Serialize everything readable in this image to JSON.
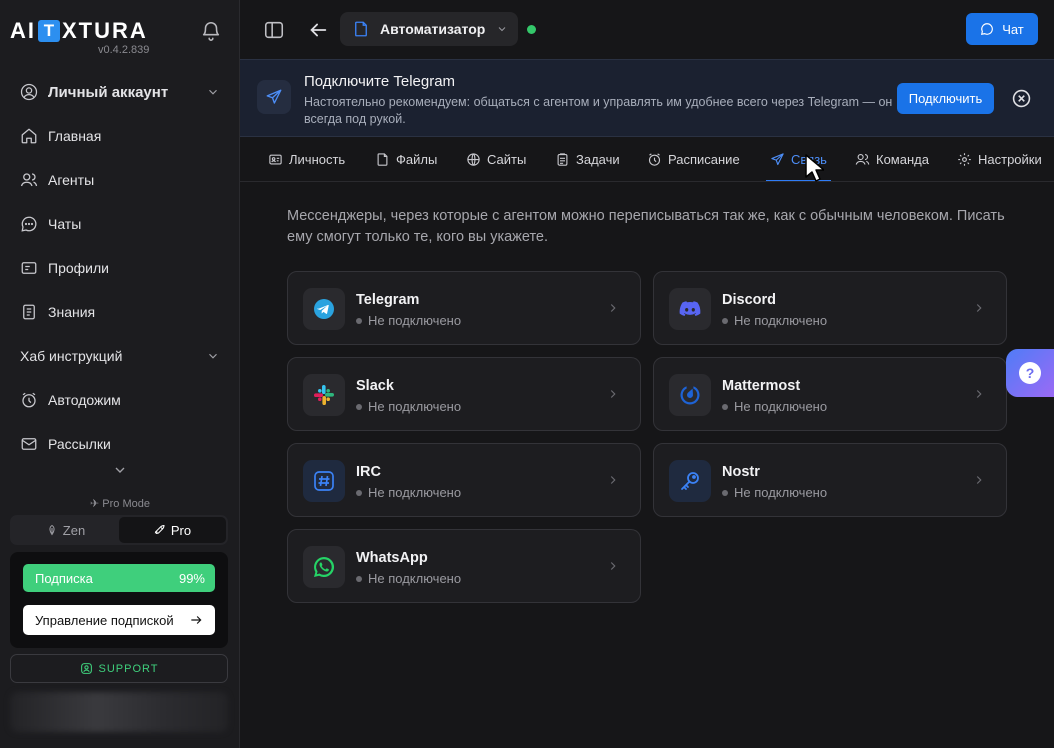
{
  "sidebar": {
    "logo_left": "AI",
    "logo_box": "T",
    "logo_right": "XTURA",
    "version": "v0.4.2.839",
    "items": [
      {
        "label": "Личный аккаунт"
      },
      {
        "label": "Главная"
      },
      {
        "label": "Агенты"
      },
      {
        "label": "Чаты"
      },
      {
        "label": "Профили"
      },
      {
        "label": "Знания"
      },
      {
        "label": "Хаб инструкций"
      },
      {
        "label": "Автодожим"
      },
      {
        "label": "Рассылки"
      }
    ],
    "mode_label": "Pro Mode",
    "modes": {
      "zen": "Zen",
      "pro": "Pro"
    },
    "subscription": {
      "label": "Подписка",
      "percent": "99%",
      "manage": "Управление подпиской"
    },
    "support": "SUPPORT"
  },
  "topbar": {
    "agent_name": "Автоматизатор",
    "chat_button": "Чат"
  },
  "banner": {
    "title": "Подключите Telegram",
    "text": "Настоятельно рекомендуем: общаться с агентом и управлять им удобнее всего через Telegram — он всегда под рукой.",
    "button": "Подключить"
  },
  "tabs": [
    {
      "label": "Личность"
    },
    {
      "label": "Файлы"
    },
    {
      "label": "Сайты"
    },
    {
      "label": "Задачи"
    },
    {
      "label": "Расписание"
    },
    {
      "label": "Связь"
    },
    {
      "label": "Команда"
    },
    {
      "label": "Настройки"
    }
  ],
  "content": {
    "description": "Мессенджеры, через которые с агентом можно переписываться так же, как с обычным человеком. Писать ему смогут только те, кого вы укажете.",
    "channels": [
      {
        "name": "Telegram",
        "status": "Не подключено",
        "icon": "telegram-icon",
        "color": "#2aa3df"
      },
      {
        "name": "Discord",
        "status": "Не подключено",
        "icon": "discord-icon",
        "color": "#5865f2"
      },
      {
        "name": "Slack",
        "status": "Не подключено",
        "icon": "slack-icon",
        "color": "#e01e5a"
      },
      {
        "name": "Mattermost",
        "status": "Не подключено",
        "icon": "mattermost-icon",
        "color": "#1e63d6"
      },
      {
        "name": "IRC",
        "status": "Не подключено",
        "icon": "hash-icon",
        "color": "#3b82f6"
      },
      {
        "name": "Nostr",
        "status": "Не подключено",
        "icon": "key-icon",
        "color": "#3b82f6"
      },
      {
        "name": "WhatsApp",
        "status": "Не подключено",
        "icon": "whatsapp-icon",
        "color": "#25d366"
      }
    ]
  },
  "help_glyph": "?"
}
